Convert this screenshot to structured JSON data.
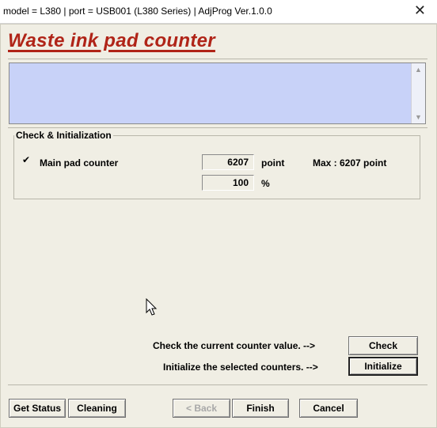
{
  "window": {
    "title": "model = L380 | port = USB001 (L380 Series) | AdjProg Ver.1.0.0",
    "close_glyph": "✕"
  },
  "heading": "Waste ink pad counter",
  "message_box": {
    "text": ""
  },
  "group": {
    "title": "Check & Initialization",
    "rows": [
      {
        "checked": true,
        "check_glyph": "✔",
        "label": "Main pad counter",
        "value": "6207",
        "unit": "point",
        "max_text": "Max : 6207 point"
      },
      {
        "value": "100",
        "unit": "%"
      }
    ]
  },
  "actions": {
    "check_prompt": "Check the current counter value. -->",
    "check_label": "Check",
    "init_prompt": "Initialize the selected counters. -->",
    "init_label": "Initialize"
  },
  "footer": {
    "get_status": "Get Status",
    "cleaning": "Cleaning",
    "back": "< Back",
    "finish": "Finish",
    "cancel": "Cancel"
  },
  "icons": {
    "scroll_up": "▲",
    "scroll_down": "▼",
    "cursor": "mouse-pointer-icon"
  }
}
